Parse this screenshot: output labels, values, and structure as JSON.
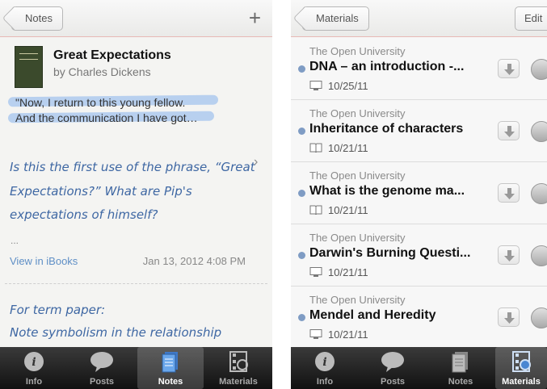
{
  "left": {
    "nav": {
      "back_label": "Notes",
      "add_icon": "plus-icon"
    },
    "book": {
      "title": "Great Expectations",
      "author": "by Charles Dickens"
    },
    "quote": {
      "line1": "\"Now, I return to this young fellow.",
      "line2": "And the communication I have got…"
    },
    "note1": {
      "lines": [
        "Is this the first use of the phrase, “Great",
        "Expectations?” What are Pip's",
        "expectations of himself?"
      ],
      "ellipsis": "...",
      "link": "View in iBooks",
      "date": "Jan 13, 2012 4:08 PM"
    },
    "note2": {
      "lines": [
        "For term paper:",
        "Note symbolism in the relationship"
      ]
    },
    "tabs": [
      {
        "label": "Info",
        "icon": "info-icon"
      },
      {
        "label": "Posts",
        "icon": "speech-bubble-icon"
      },
      {
        "label": "Notes",
        "icon": "notes-icon",
        "active": true
      },
      {
        "label": "Materials",
        "icon": "film-reel-icon"
      }
    ]
  },
  "right": {
    "nav": {
      "back_label": "Materials",
      "edit_label": "Edit"
    },
    "materials": [
      {
        "publisher": "The Open University",
        "title": "DNA – an introduction -...",
        "type_icon": "monitor-icon",
        "date": "10/25/11"
      },
      {
        "publisher": "The Open University",
        "title": "Inheritance of characters",
        "type_icon": "book-icon",
        "date": "10/21/11"
      },
      {
        "publisher": "The Open University",
        "title": "What is the genome ma...",
        "type_icon": "book-icon",
        "date": "10/21/11"
      },
      {
        "publisher": "The Open University",
        "title": "Darwin's Burning Questi...",
        "type_icon": "monitor-icon",
        "date": "10/21/11"
      },
      {
        "publisher": "The Open University",
        "title": "Mendel and Heredity",
        "type_icon": "monitor-icon",
        "date": "10/21/11"
      }
    ],
    "tabs": [
      {
        "label": "Info",
        "icon": "info-icon"
      },
      {
        "label": "Posts",
        "icon": "speech-bubble-icon"
      },
      {
        "label": "Notes",
        "icon": "notes-icon"
      },
      {
        "label": "Materials",
        "icon": "film-reel-icon",
        "active": true
      }
    ]
  },
  "colors": {
    "accent_blue": "#5f8fc6",
    "handwriting": "#3e67a3",
    "highlight": "#a9c7ee",
    "nav_border": "#e7b9b5"
  }
}
